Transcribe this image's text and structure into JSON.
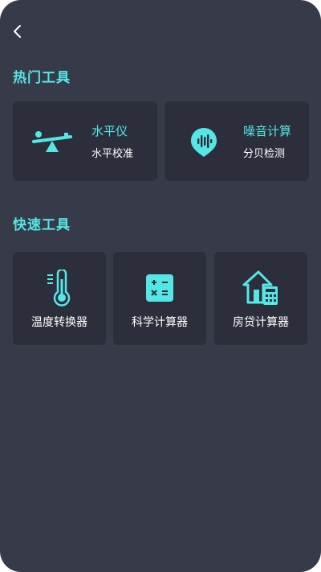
{
  "colors": {
    "background": "#373a48",
    "card": "#2c2f3b",
    "accent": "#55e6e6",
    "text": "#ffffff"
  },
  "nav": {
    "back_icon": "chevron-left-icon"
  },
  "hot_tools": {
    "title": "热门工具",
    "items": [
      {
        "title": "水平仪",
        "subtitle": "水平校准",
        "icon": "seesaw-level-icon"
      },
      {
        "title": "噪音计算",
        "subtitle": "分贝检测",
        "icon": "sound-wave-pin-icon"
      }
    ]
  },
  "quick_tools": {
    "title": "快速工具",
    "items": [
      {
        "label": "温度转换器",
        "icon": "thermometer-icon"
      },
      {
        "label": "科学计算器",
        "icon": "calculator-icon"
      },
      {
        "label": "房贷计算器",
        "icon": "house-calculator-icon"
      }
    ]
  }
}
